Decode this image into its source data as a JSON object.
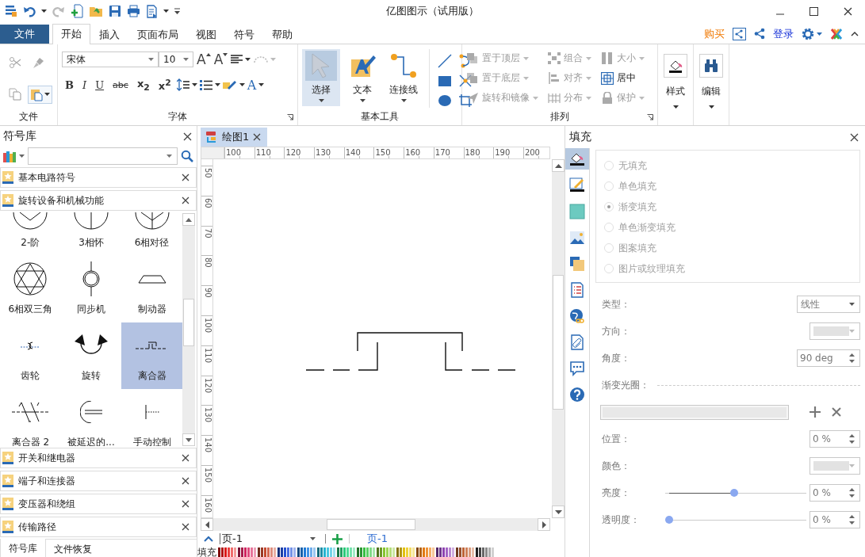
{
  "window": {
    "title": "亿图图示（试用版）"
  },
  "menu": {
    "file_tab": "文件",
    "tabs": [
      {
        "label": "开始",
        "selected": true
      },
      {
        "label": "插入",
        "selected": false
      },
      {
        "label": "页面布局",
        "selected": false
      },
      {
        "label": "视图",
        "selected": false
      },
      {
        "label": "符号",
        "selected": false
      },
      {
        "label": "帮助",
        "selected": false
      }
    ],
    "buy": "购买",
    "login": "登录"
  },
  "ribbon": {
    "file_group": {
      "label": "文件"
    },
    "font_group": {
      "label": "字体",
      "font_name": "宋体",
      "font_size": "10",
      "size_buttons": [
        "A",
        "A"
      ],
      "format_buttons": [
        "B",
        "I",
        "U",
        "abc",
        "x$_{2}$",
        "x$^{2}$"
      ],
      "font_color": "A"
    },
    "tools_group": {
      "label": "基本工具",
      "tools": [
        {
          "label": "选择",
          "selected": true
        },
        {
          "label": "文本",
          "selected": false
        },
        {
          "label": "连接线",
          "selected": false
        }
      ]
    },
    "arrange_group": {
      "label": "排列",
      "items": [
        {
          "label": "置于顶层",
          "disabled": true,
          "dropdown": true
        },
        {
          "label": "组合",
          "disabled": true,
          "dropdown": true
        },
        {
          "label": "大小",
          "disabled": true,
          "dropdown": true
        },
        {
          "label": "置于底层",
          "disabled": true,
          "dropdown": true
        },
        {
          "label": "对齐",
          "disabled": true,
          "dropdown": true
        },
        {
          "label": "居中",
          "disabled": false,
          "dropdown": false
        },
        {
          "label": "旋转和镜像",
          "disabled": true,
          "dropdown": true
        },
        {
          "label": "分布",
          "disabled": true,
          "dropdown": true
        },
        {
          "label": "保护",
          "disabled": true,
          "dropdown": true
        }
      ]
    },
    "style_button": "样式",
    "edit_button": "编辑"
  },
  "symbol_library": {
    "title": "符号库",
    "categories": [
      {
        "label": "基本电路符号"
      },
      {
        "label": "旋转设备和机械功能",
        "symbols": [
          {
            "label": "2-阶",
            "selected": false
          },
          {
            "label": "3相怀",
            "selected": false
          },
          {
            "label": "6相对径",
            "selected": false
          },
          {
            "label": "6相双三角",
            "selected": false
          },
          {
            "label": "同步机",
            "selected": false
          },
          {
            "label": "制动器",
            "selected": false
          },
          {
            "label": "齿轮",
            "selected": false
          },
          {
            "label": "旋转",
            "selected": false
          },
          {
            "label": "离合器",
            "selected": true
          },
          {
            "label": "离合器 2",
            "selected": false
          },
          {
            "label": "被延迟的...",
            "selected": false
          },
          {
            "label": "手动控制",
            "selected": false
          }
        ]
      },
      {
        "label": "开关和继电器"
      },
      {
        "label": "端子和连接器"
      },
      {
        "label": "变压器和绕组"
      },
      {
        "label": "传输路径"
      }
    ],
    "bottom_tabs": [
      {
        "label": "符号库",
        "selected": true
      },
      {
        "label": "文件恢复",
        "selected": false
      }
    ]
  },
  "document": {
    "tabs": [
      {
        "label": "绘图1",
        "selected": true
      }
    ],
    "ruler": {
      "horizontal": [
        "100",
        "110",
        "120",
        "130",
        "140",
        "150",
        "160",
        "170",
        "180",
        "190",
        "200"
      ],
      "vertical": [
        "50",
        "60",
        "70",
        "80",
        "90",
        "100",
        "110",
        "120",
        "130",
        "140",
        "150",
        "160"
      ]
    },
    "page_dropdown": "页-1",
    "page_tabs": [
      {
        "label": "页-1",
        "selected": true
      }
    ],
    "palette_label": "填充"
  },
  "fill_panel": {
    "title": "填充",
    "icon_tabs": [
      {
        "selected": true
      },
      {
        "selected": false
      },
      {
        "selected": false
      },
      {
        "selected": false
      },
      {
        "selected": false
      },
      {
        "selected": false
      },
      {
        "selected": false
      },
      {
        "selected": false
      },
      {
        "selected": false
      },
      {
        "selected": false
      }
    ],
    "options": [
      {
        "label": "无填充",
        "selected": false,
        "disabled": true
      },
      {
        "label": "单色填充",
        "selected": false,
        "disabled": true
      },
      {
        "label": "渐变填充",
        "selected": true,
        "disabled": true
      },
      {
        "label": "单色渐变填充",
        "selected": false,
        "disabled": true
      },
      {
        "label": "图案填充",
        "selected": false,
        "disabled": true
      },
      {
        "label": "图片或纹理填充",
        "selected": false,
        "disabled": true
      }
    ],
    "type": {
      "label": "类型：",
      "value": "线性"
    },
    "direction": {
      "label": "方向："
    },
    "angle": {
      "label": "角度：",
      "value": "90 deg"
    },
    "gradient_stops": {
      "label": "渐变光圈："
    },
    "position": {
      "label": "位置：",
      "value": "0 %"
    },
    "color": {
      "label": "颜色："
    },
    "brightness": {
      "label": "亮度：",
      "level": 0.49,
      "value": "0 %"
    },
    "transparency": {
      "label": "透明度：",
      "level": 0,
      "value": "0 %"
    }
  }
}
